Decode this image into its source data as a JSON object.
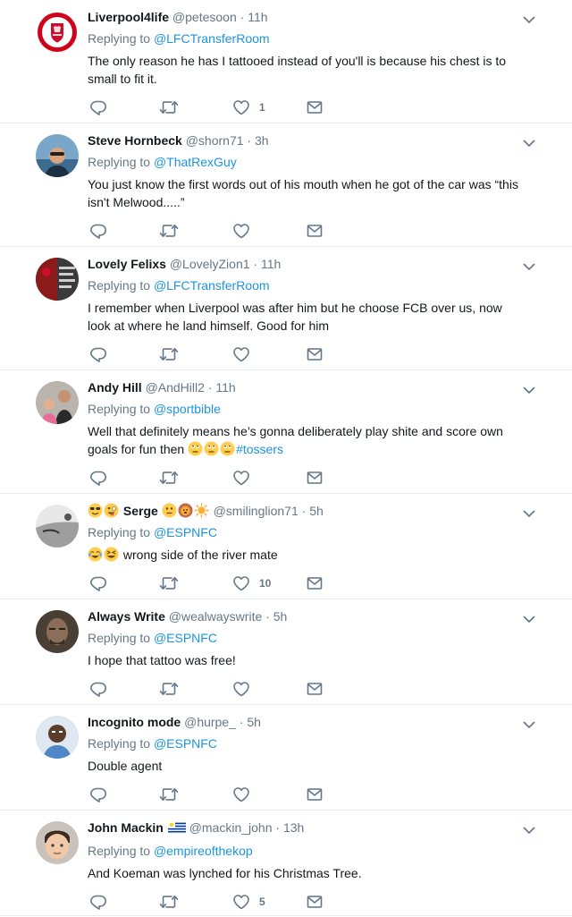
{
  "colors": {
    "link": "#1b95e0",
    "meta": "#657786",
    "text": "#14171a",
    "divider": "#e6ecf0"
  },
  "icons": {
    "reply": "reply-icon",
    "retweet": "retweet-icon",
    "like": "heart-icon",
    "dm": "envelope-icon",
    "more": "chevron-down-icon"
  },
  "tweets": [
    {
      "name": "Liverpool4life",
      "handle": "@petesoon",
      "sep": "·",
      "time": "11h",
      "replying_label": "Replying to",
      "reply_to": "@LFCTransferRoom",
      "text": "The only reason he has I tattooed  instead of you'll is because his chest is to small to fit it.",
      "likes": "1"
    },
    {
      "name": "Steve Hornbeck",
      "handle": "@shorn71",
      "sep": "·",
      "time": "3h",
      "replying_label": "Replying to",
      "reply_to": "@ThatRexGuy",
      "text": "You just know the first words out of his mouth when he got of the car was “this isn't Melwood.....”",
      "likes": ""
    },
    {
      "name": "Lovely Felixs",
      "handle": "@LovelyZion1",
      "sep": "·",
      "time": "11h",
      "replying_label": "Replying to",
      "reply_to": "@LFCTransferRoom",
      "text": "I remember when Liverpool was after him but he choose FCB over us, now look at where he land himself. Good for him",
      "likes": ""
    },
    {
      "name": "Andy Hill",
      "handle": "@AndHill2",
      "sep": "·",
      "time": "11h",
      "replying_label": "Replying to",
      "reply_to": "@sportbible",
      "text": "Well that definitely means he’s gonna deliberately play shite and score own goals for fun then",
      "hashtag": "#tossers",
      "likes": ""
    },
    {
      "name": "Serge",
      "handle": "@smilinglion71",
      "sep": "·",
      "time": "5h",
      "replying_label": "Replying to",
      "reply_to": "@ESPNFC",
      "text": "wrong side of the river mate",
      "likes": "10"
    },
    {
      "name": "Always Write",
      "handle": "@wealwayswrite",
      "sep": "·",
      "time": "5h",
      "replying_label": "Replying to",
      "reply_to": "@ESPNFC",
      "text": "I hope that tattoo was free!",
      "likes": ""
    },
    {
      "name": "Incognito mode",
      "handle": "@hurpe_",
      "sep": "·",
      "time": "5h",
      "replying_label": "Replying to",
      "reply_to": "@ESPNFC",
      "text": "Double agent",
      "likes": ""
    },
    {
      "name": "John Mackin",
      "handle": "@mackin_john",
      "sep": "·",
      "time": "13h",
      "replying_label": "Replying to",
      "reply_to": "@empireofthekop",
      "text": "And Koeman was lynched for his Christmas Tree.",
      "likes": "5"
    }
  ]
}
